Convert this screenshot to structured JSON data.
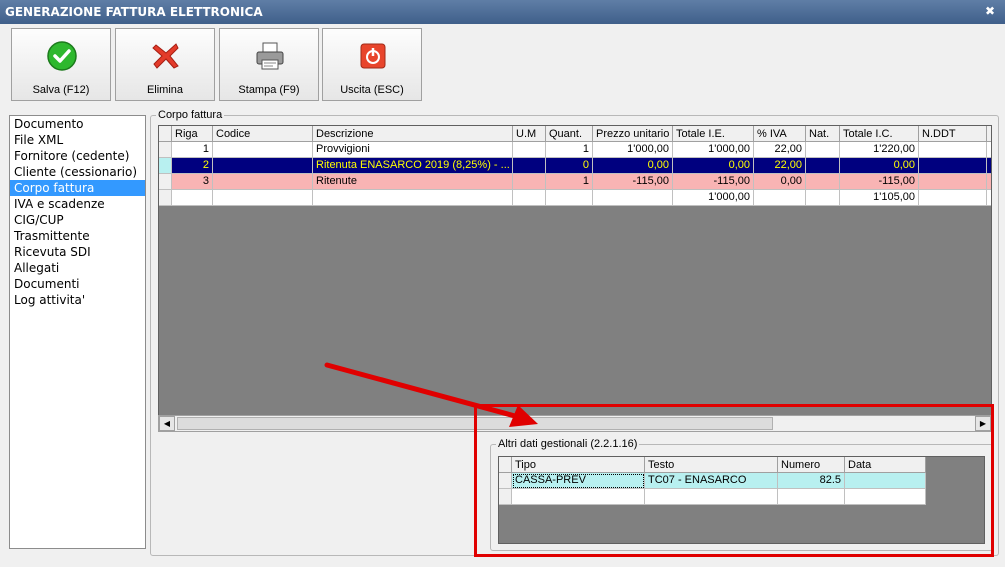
{
  "window": {
    "title": "GENERAZIONE FATTURA ELETTRONICA",
    "close": "✖"
  },
  "toolbar": {
    "save": "Salva (F12)",
    "delete": "Elimina",
    "print": "Stampa (F9)",
    "exit": "Uscita (ESC)"
  },
  "nav": {
    "items": [
      "Documento",
      "File XML",
      "Fornitore (cedente)",
      "Cliente (cessionario)",
      "Corpo fattura",
      "IVA e scadenze",
      "CIG/CUP",
      "Trasmittente",
      "Ricevuta SDI",
      "Allegati",
      "Documenti",
      "Log attivita'"
    ],
    "selected": "Corpo fattura"
  },
  "corpo": {
    "title": "Corpo fattura",
    "columns": [
      "Riga",
      "Codice",
      "Descrizione",
      "U.M",
      "Quant.",
      "Prezzo unitario",
      "Totale I.E.",
      "% IVA",
      "Nat.",
      "Totale I.C.",
      "N.DDT"
    ],
    "rows": [
      [
        "1",
        "",
        "Provvigioni",
        "",
        "1",
        "1'000,00",
        "1'000,00",
        "22,00",
        "",
        "1'220,00",
        ""
      ],
      [
        "2",
        "",
        "Ritenuta ENASARCO 2019 (8,25%) - ...",
        "",
        "0",
        "0,00",
        "0,00",
        "22,00",
        "",
        "0,00",
        ""
      ],
      [
        "3",
        "",
        "Ritenute",
        "",
        "1",
        "-115,00",
        "-115,00",
        "0,00",
        "",
        "-115,00",
        ""
      ],
      [
        "",
        "",
        "",
        "",
        "",
        "",
        "1'000,00",
        "",
        "",
        "1'105,00",
        ""
      ]
    ]
  },
  "altri": {
    "title": "Altri dati gestionali (2.2.1.16)",
    "columns": [
      "Tipo",
      "Testo",
      "Numero",
      "Data"
    ],
    "rows": [
      [
        "CASSA-PREV",
        "TC07 - ENASARCO",
        "82.5",
        ""
      ],
      [
        "",
        "",
        "",
        ""
      ]
    ]
  },
  "colors": {
    "selected_row": "#00007f",
    "selected_text": "#ffff00",
    "pink_row": "#f9b4b4",
    "cyan_row": "#b8f0f0",
    "highlight_box": "#e00000"
  }
}
